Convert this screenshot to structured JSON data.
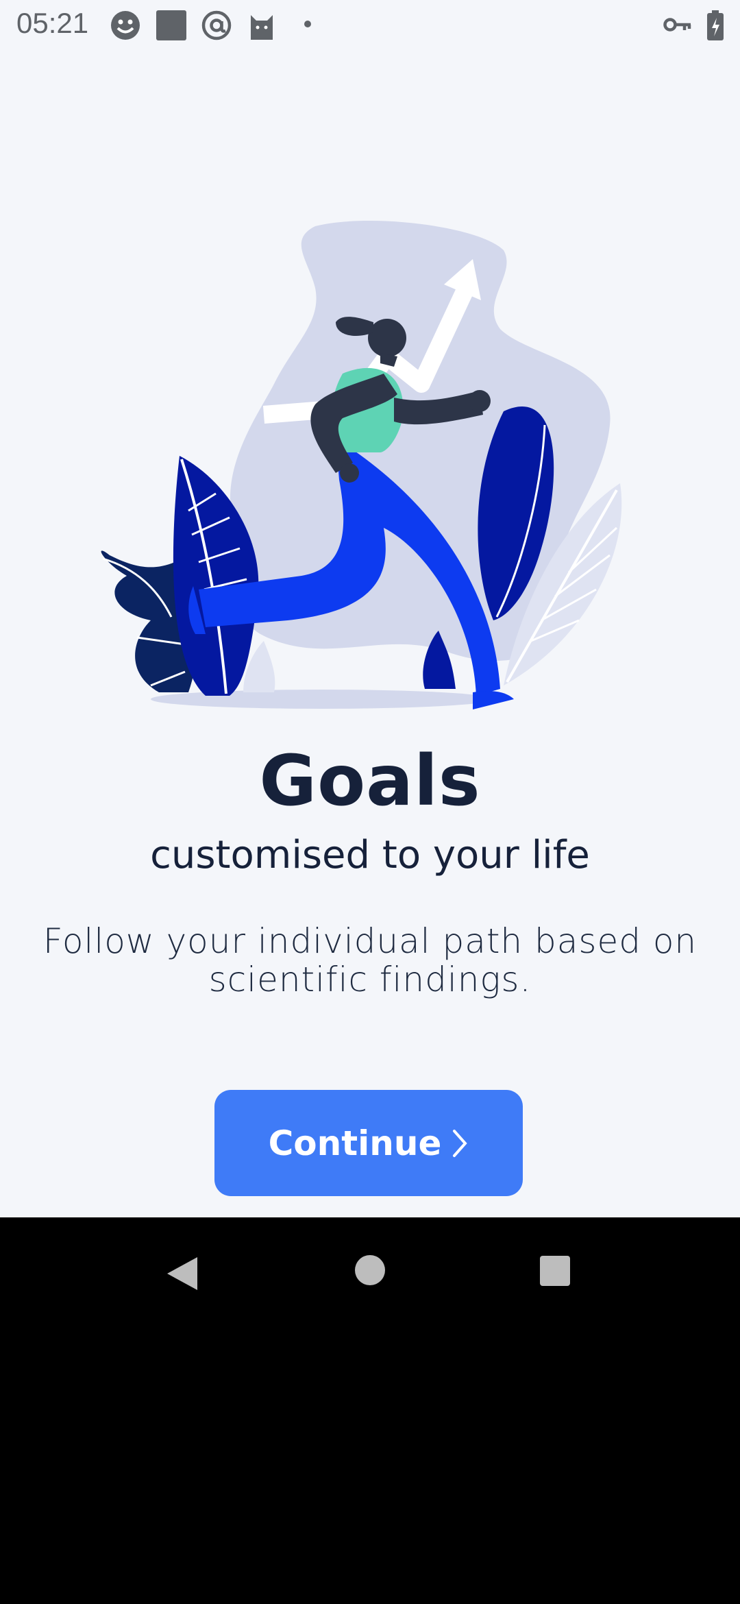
{
  "status_bar": {
    "time": "05:21",
    "icons": [
      "smiley-icon",
      "square-icon",
      "at-sign-icon",
      "cat-icon",
      "dot-icon"
    ],
    "right_icons": [
      "key-icon",
      "battery-icon"
    ]
  },
  "onboarding": {
    "title": "Goals",
    "subtitle": "customised to your life",
    "description": "Follow your individual path based on scientific findings.",
    "continue_label": "Continue"
  },
  "colors": {
    "accent": "#3f7bf7",
    "background": "#f4f6fa",
    "text": "#16213a"
  },
  "nav_bar": {
    "buttons": [
      "back-icon",
      "home-icon",
      "recents-icon"
    ]
  }
}
